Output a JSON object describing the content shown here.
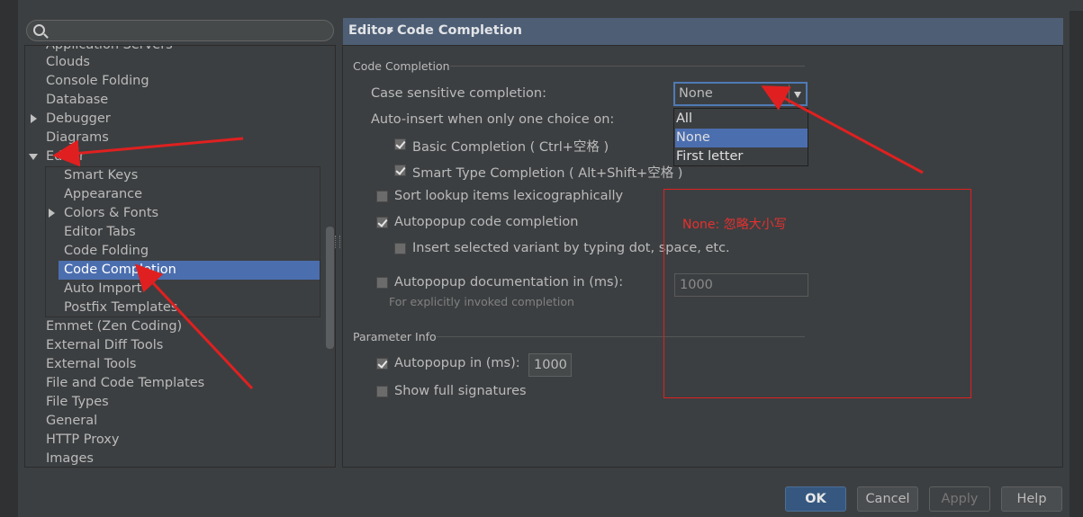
{
  "sidebar": {
    "search_placeholder": "",
    "items": [
      {
        "label": "Application Servers"
      },
      {
        "label": "Clouds"
      },
      {
        "label": "Console Folding"
      },
      {
        "label": "Database"
      },
      {
        "label": "Debugger"
      },
      {
        "label": "Diagrams"
      },
      {
        "label": "Editor"
      },
      {
        "label": "Smart Keys"
      },
      {
        "label": "Appearance"
      },
      {
        "label": "Colors & Fonts"
      },
      {
        "label": "Editor Tabs"
      },
      {
        "label": "Code Folding"
      },
      {
        "label": "Code Completion"
      },
      {
        "label": "Auto Import"
      },
      {
        "label": "Postfix Templates"
      },
      {
        "label": "Emmet (Zen Coding)"
      },
      {
        "label": "External Diff Tools"
      },
      {
        "label": "External Tools"
      },
      {
        "label": "File and Code Templates"
      },
      {
        "label": "File Types"
      },
      {
        "label": "General"
      },
      {
        "label": "HTTP Proxy"
      },
      {
        "label": "Images"
      }
    ]
  },
  "header": {
    "breadcrumb_parent": "Editor",
    "breadcrumb_current": "Code Completion"
  },
  "code_completion": {
    "section_title": "Code Completion",
    "case_sensitive_label": "Case sensitive completion:",
    "case_sensitive_value": "None",
    "dropdown_options": [
      "All",
      "None",
      "First letter"
    ],
    "auto_insert_label": "Auto-insert when only one choice on:",
    "basic_completion": "Basic Completion ( Ctrl+空格 )",
    "smart_type_completion": "Smart Type Completion ( Alt+Shift+空格 )",
    "sort_lookup": "Sort lookup items lexicographically",
    "autopopup_code": "Autopopup code completion",
    "insert_selected": "Insert selected variant by typing dot, space, etc.",
    "autopopup_doc": "Autopopup documentation in (ms):",
    "autopopup_doc_value": "1000",
    "autopopup_doc_hint": "For explicitly invoked completion"
  },
  "parameter_info": {
    "section_title": "Parameter Info",
    "autopopup_label": "Autopopup in (ms):",
    "autopopup_value": "1000",
    "show_full_signatures": "Show full signatures"
  },
  "annotation": {
    "note": "None: 忽略大小写",
    "color": "#e02020"
  },
  "buttons": {
    "ok": "OK",
    "cancel": "Cancel",
    "apply": "Apply",
    "help": "Help"
  },
  "colors": {
    "selection": "#4b6eaf",
    "header": "#4d5e75",
    "background": "#3c3f41"
  }
}
